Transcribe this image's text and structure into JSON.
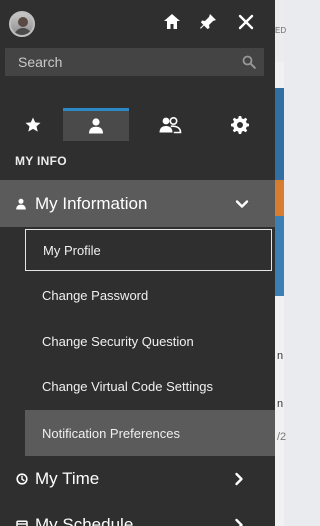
{
  "background": {
    "visible_text_ed": "ED",
    "visible_mark_n": "n",
    "visible_mark_n2": "n",
    "visible_mark_slash": "/2"
  },
  "panel": {
    "search": {
      "placeholder": "Search"
    },
    "tabs": [
      {
        "name": "favorites",
        "icon": "star-icon"
      },
      {
        "name": "my-info",
        "icon": "person-icon",
        "active": true
      },
      {
        "name": "team",
        "icon": "people-icon"
      },
      {
        "name": "settings",
        "icon": "gear-icon"
      }
    ],
    "section_label": "MY INFO",
    "groups": {
      "my_information": {
        "label": "My Information",
        "items": [
          {
            "label": "My Profile"
          },
          {
            "label": "Change Password"
          },
          {
            "label": "Change Security Question"
          },
          {
            "label": "Change Virtual Code Settings"
          },
          {
            "label": "Notification Preferences"
          }
        ]
      },
      "my_time": {
        "label": "My Time"
      },
      "my_schedule": {
        "label": "My Schedule"
      }
    },
    "colors": {
      "panel_bg": "#2f2f2f",
      "active_tab_bg": "#4a4a4a",
      "active_tab_accent": "#2d89c6",
      "group_header_bg": "#5b5b5b"
    }
  }
}
